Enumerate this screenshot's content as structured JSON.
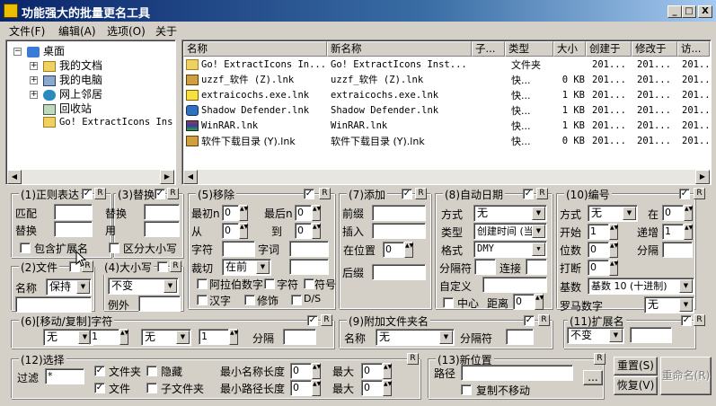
{
  "window": {
    "title": "功能强大的批量更名工具",
    "min": "_",
    "max": "□",
    "close": "X"
  },
  "menu": [
    "文件(F)",
    "编辑(A)",
    "选项(O)",
    "关于"
  ],
  "tree": [
    {
      "label": "桌面",
      "expander": "−"
    },
    {
      "label": "我的文档",
      "expander": "+"
    },
    {
      "label": "我的电脑",
      "expander": "+"
    },
    {
      "label": "网上邻居",
      "expander": "+"
    },
    {
      "label": "回收站",
      "expander": ""
    },
    {
      "label": "Go! ExtractIcons Ins",
      "expander": ""
    }
  ],
  "list": {
    "columns": [
      "名称",
      "新名称",
      "子...",
      "类型",
      "大小",
      "创建于",
      "修改于",
      "访..."
    ],
    "rows": [
      [
        "Go! ExtractIcons In...",
        "Go! ExtractIcons Inst...",
        "",
        "文件夹",
        "",
        "201...",
        "201...",
        "201..."
      ],
      [
        " uzzf_软件 (Z).lnk",
        " uzzf_软件 (Z).lnk",
        "",
        "快...",
        "0 KB",
        "201...",
        "201...",
        "201..."
      ],
      [
        "extraicochs.exe.lnk",
        "extraicochs.exe.lnk",
        "",
        "快...",
        "1 KB",
        "201...",
        "201...",
        "201..."
      ],
      [
        "Shadow Defender.lnk",
        "Shadow Defender.lnk",
        "",
        "快...",
        "1 KB",
        "201...",
        "201...",
        "201..."
      ],
      [
        "WinRAR.lnk",
        "WinRAR.lnk",
        "",
        "快...",
        "1 KB",
        "201...",
        "201...",
        "201..."
      ],
      [
        "软件下载目录 (Y).lnk",
        "软件下载目录 (Y).lnk",
        "",
        "快...",
        "0 KB",
        "201...",
        "201...",
        "201..."
      ]
    ]
  },
  "regex": {
    "title": "(1)正则表达",
    "match": "匹配",
    "replace": "替换",
    "include_ext": "包含扩展名"
  },
  "replace": {
    "title": "(3)替换",
    "replace": "替换",
    "with": "用",
    "case_sensitive": "区分大小写"
  },
  "remove": {
    "title": "(5)移除",
    "first_n": "最初n",
    "last_n": "最后n",
    "from": "从",
    "to": "到",
    "chars": "字符",
    "words": "字词",
    "trim": "裁切",
    "trim_value": "在前",
    "arabic": "阿拉伯数字",
    "symbol_chars": "字符",
    "symbols": "符号",
    "hanzi": "汉字",
    "accents": "修饰",
    "ds": "D/S",
    "v_first": "0",
    "v_last": "0",
    "v_from": "0",
    "v_to": "0"
  },
  "add": {
    "title": "(7)添加",
    "prefix": "前缀",
    "insert": "插入",
    "at_pos": "在位置",
    "pos_value": "0",
    "suffix": "后缀"
  },
  "autodate": {
    "title": "(8)自动日期",
    "mode": "方式",
    "mode_value": "无",
    "type": "类型",
    "type_value": "创建时间 (当",
    "format": "格式",
    "format_value": "DMY",
    "separator": "分隔符",
    "connect": "连接",
    "custom": "自定义",
    "center": "中心",
    "distance": "距离",
    "distance_value": "0"
  },
  "numbering": {
    "title": "(10)编号",
    "mode": "方式",
    "mode_value": "无",
    "at": "在",
    "at_value": "0",
    "start": "开始",
    "start_value": "1",
    "step": "递增",
    "step_value": "1",
    "digits": "位数",
    "digits_value": "0",
    "sep": "分隔",
    "break": "打断",
    "break_value": "0",
    "base": "基数",
    "base_value": "基数 10 (十进制)",
    "roman": "罗马数字",
    "roman_value": "无"
  },
  "file": {
    "title": "(2)文件",
    "name": "名称",
    "name_value": "保持"
  },
  "case": {
    "title": "(4)大小写",
    "value": "不变",
    "except": "例外"
  },
  "movecopy": {
    "title": "(6)[移动/复制]字符",
    "a": "无",
    "b": "1",
    "c": "无",
    "d": "1",
    "sep": "分隔"
  },
  "folder": {
    "title": "(9)附加文件夹名",
    "name": "名称",
    "name_value": "无",
    "sep": "分隔符"
  },
  "ext": {
    "title": "(11)扩展名",
    "value": "不变"
  },
  "select": {
    "title": "(12)选择",
    "filter": "过滤",
    "filter_value": "*",
    "folders": "文件夹",
    "hidden": "隐藏",
    "files": "文件",
    "subfolders": "子文件夹",
    "min_name": "最小名称长度",
    "max1": "最大",
    "min_path": "最小路径长度",
    "max2": "最大",
    "v": "0"
  },
  "location": {
    "title": "(13)新位置",
    "path": "路径",
    "browse": "...",
    "copy": "复制不移动"
  },
  "buttons": {
    "reset": "重置(S)",
    "restore": "恢复(V)",
    "rename": "重命名(R)"
  },
  "r": "R",
  "check": "✓"
}
